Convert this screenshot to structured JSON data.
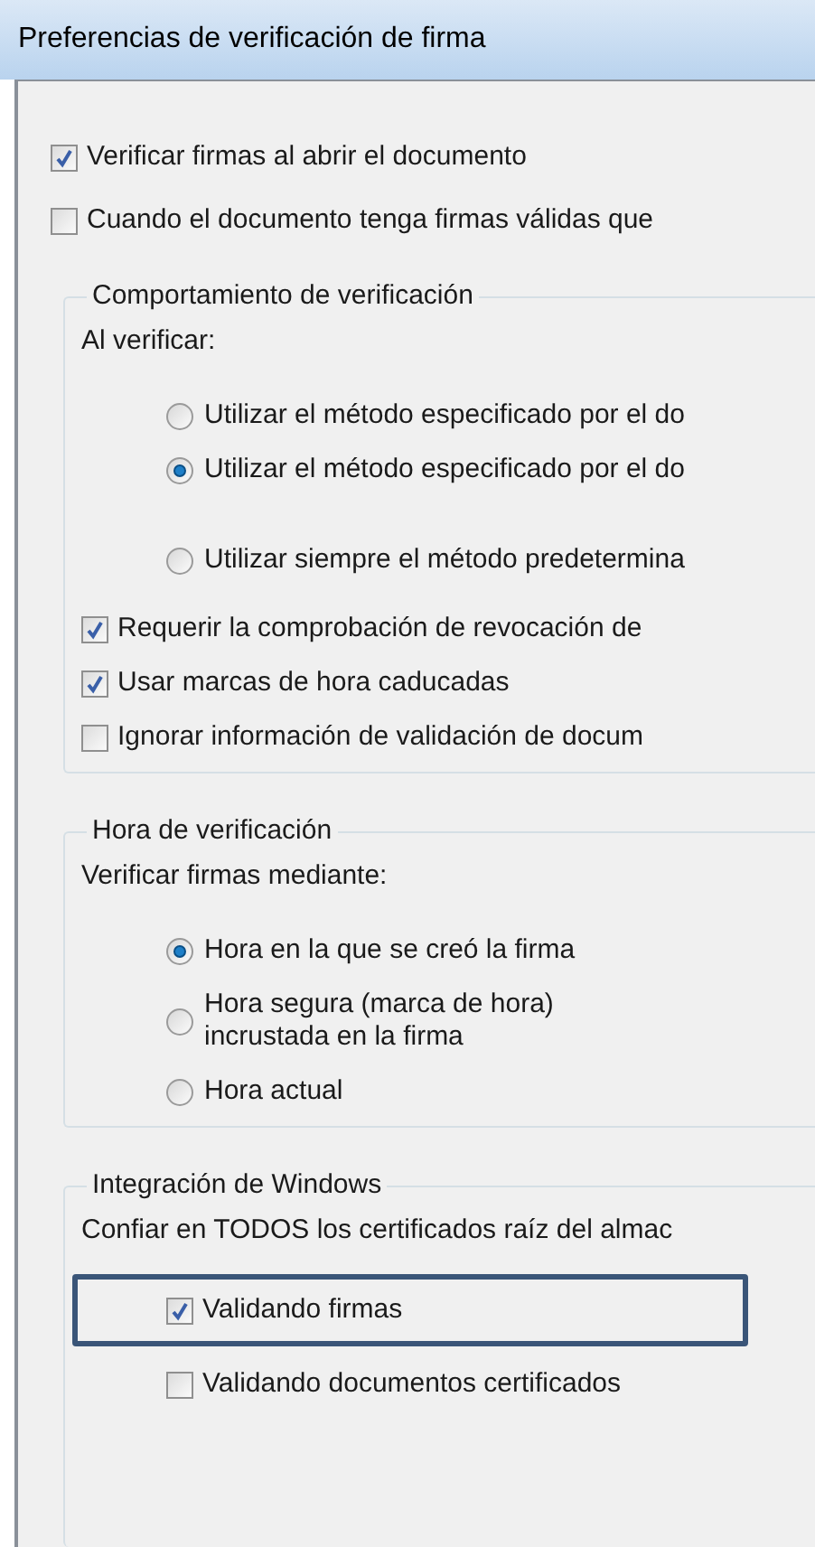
{
  "window": {
    "title": "Preferencias de verificación de firma"
  },
  "options": [
    {
      "label": "Verificar firmas al abrir el documento",
      "checked": true
    },
    {
      "label": "Cuando el documento tenga firmas válidas que",
      "checked": false
    }
  ],
  "groups": [
    {
      "title": "Comportamiento de verificación",
      "prompt": "Al verificar:",
      "items": [
        {
          "kind": "radio",
          "label": "Utilizar el método especificado por el do",
          "selected": false
        },
        {
          "kind": "radio",
          "label": "Utilizar el método especificado por el do",
          "selected": true
        },
        {
          "kind": "radio",
          "label": "Utilizar siempre el método predetermina",
          "selected": false
        },
        {
          "kind": "checkbox",
          "label": "Requerir la comprobación de revocación de",
          "checked": true
        },
        {
          "kind": "checkbox",
          "label": "Usar marcas de hora caducadas",
          "checked": true
        },
        {
          "kind": "checkbox",
          "label": "Ignorar información de validación de docum",
          "checked": false
        }
      ]
    },
    {
      "title": "Hora de verificación",
      "prompt": "Verificar firmas mediante:",
      "items": [
        {
          "kind": "radio",
          "label": "Hora en la que se creó la firma",
          "selected": true
        },
        {
          "kind": "radio",
          "label": "Hora segura (marca de hora) incrustada en la firma",
          "selected": false
        },
        {
          "kind": "radio",
          "label": "Hora actual",
          "selected": false
        }
      ]
    },
    {
      "title": "Integración de Windows",
      "prompt": "Confiar en TODOS los certificados raíz del almac",
      "items": [
        {
          "kind": "checkbox",
          "label": "Validando firmas",
          "checked": true,
          "highlighted": true
        },
        {
          "kind": "checkbox",
          "label": "Validando documentos certificados",
          "checked": false,
          "highlighted": false
        }
      ]
    }
  ]
}
